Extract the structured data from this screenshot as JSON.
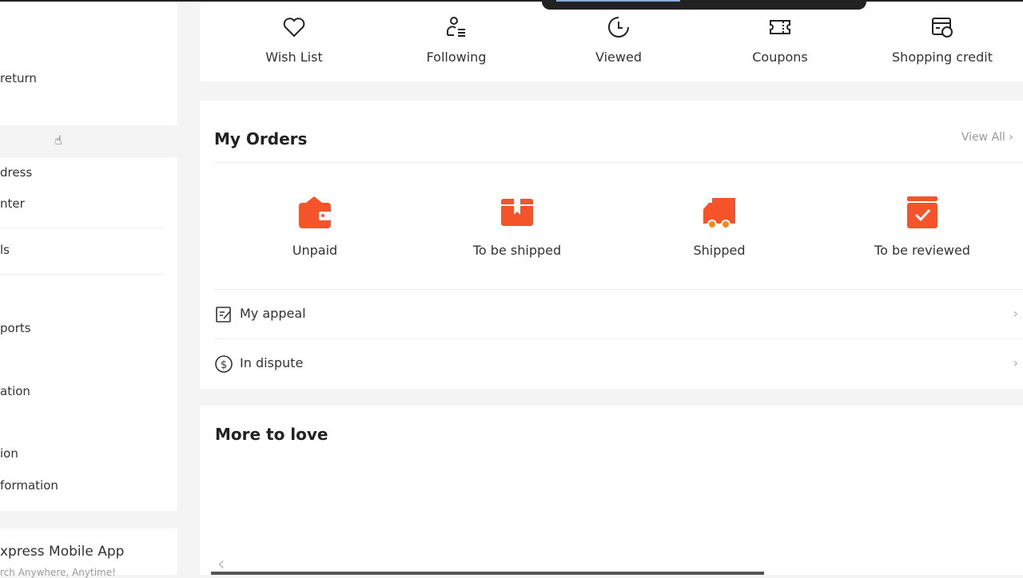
{
  "sidebar": {
    "items": [
      "return",
      "dress",
      "nter",
      "ls",
      "ports",
      "ation",
      "ion",
      "formation"
    ],
    "app_title": "xpress Mobile App",
    "app_subtitle": "rch Anywhere, Anytime!"
  },
  "quick_links": [
    {
      "label": "Wish List",
      "icon": "heart-icon"
    },
    {
      "label": "Following",
      "icon": "following-icon"
    },
    {
      "label": "Viewed",
      "icon": "clock-icon"
    },
    {
      "label": "Coupons",
      "icon": "coupon-icon"
    },
    {
      "label": "Shopping credit",
      "icon": "credit-icon"
    }
  ],
  "orders": {
    "title": "My Orders",
    "view_all": "View All",
    "statuses": [
      {
        "label": "Unpaid",
        "icon": "wallet-icon"
      },
      {
        "label": "To be shipped",
        "icon": "box-icon"
      },
      {
        "label": "Shipped",
        "icon": "truck-icon"
      },
      {
        "label": "To be reviewed",
        "icon": "review-icon"
      }
    ],
    "links": [
      {
        "label": "My appeal",
        "icon": "appeal-icon"
      },
      {
        "label": "In dispute",
        "icon": "dollar-icon"
      }
    ]
  },
  "more": {
    "title": "More to love"
  },
  "colors": {
    "accent": "#f5542a",
    "background": "#f4f4f4"
  }
}
